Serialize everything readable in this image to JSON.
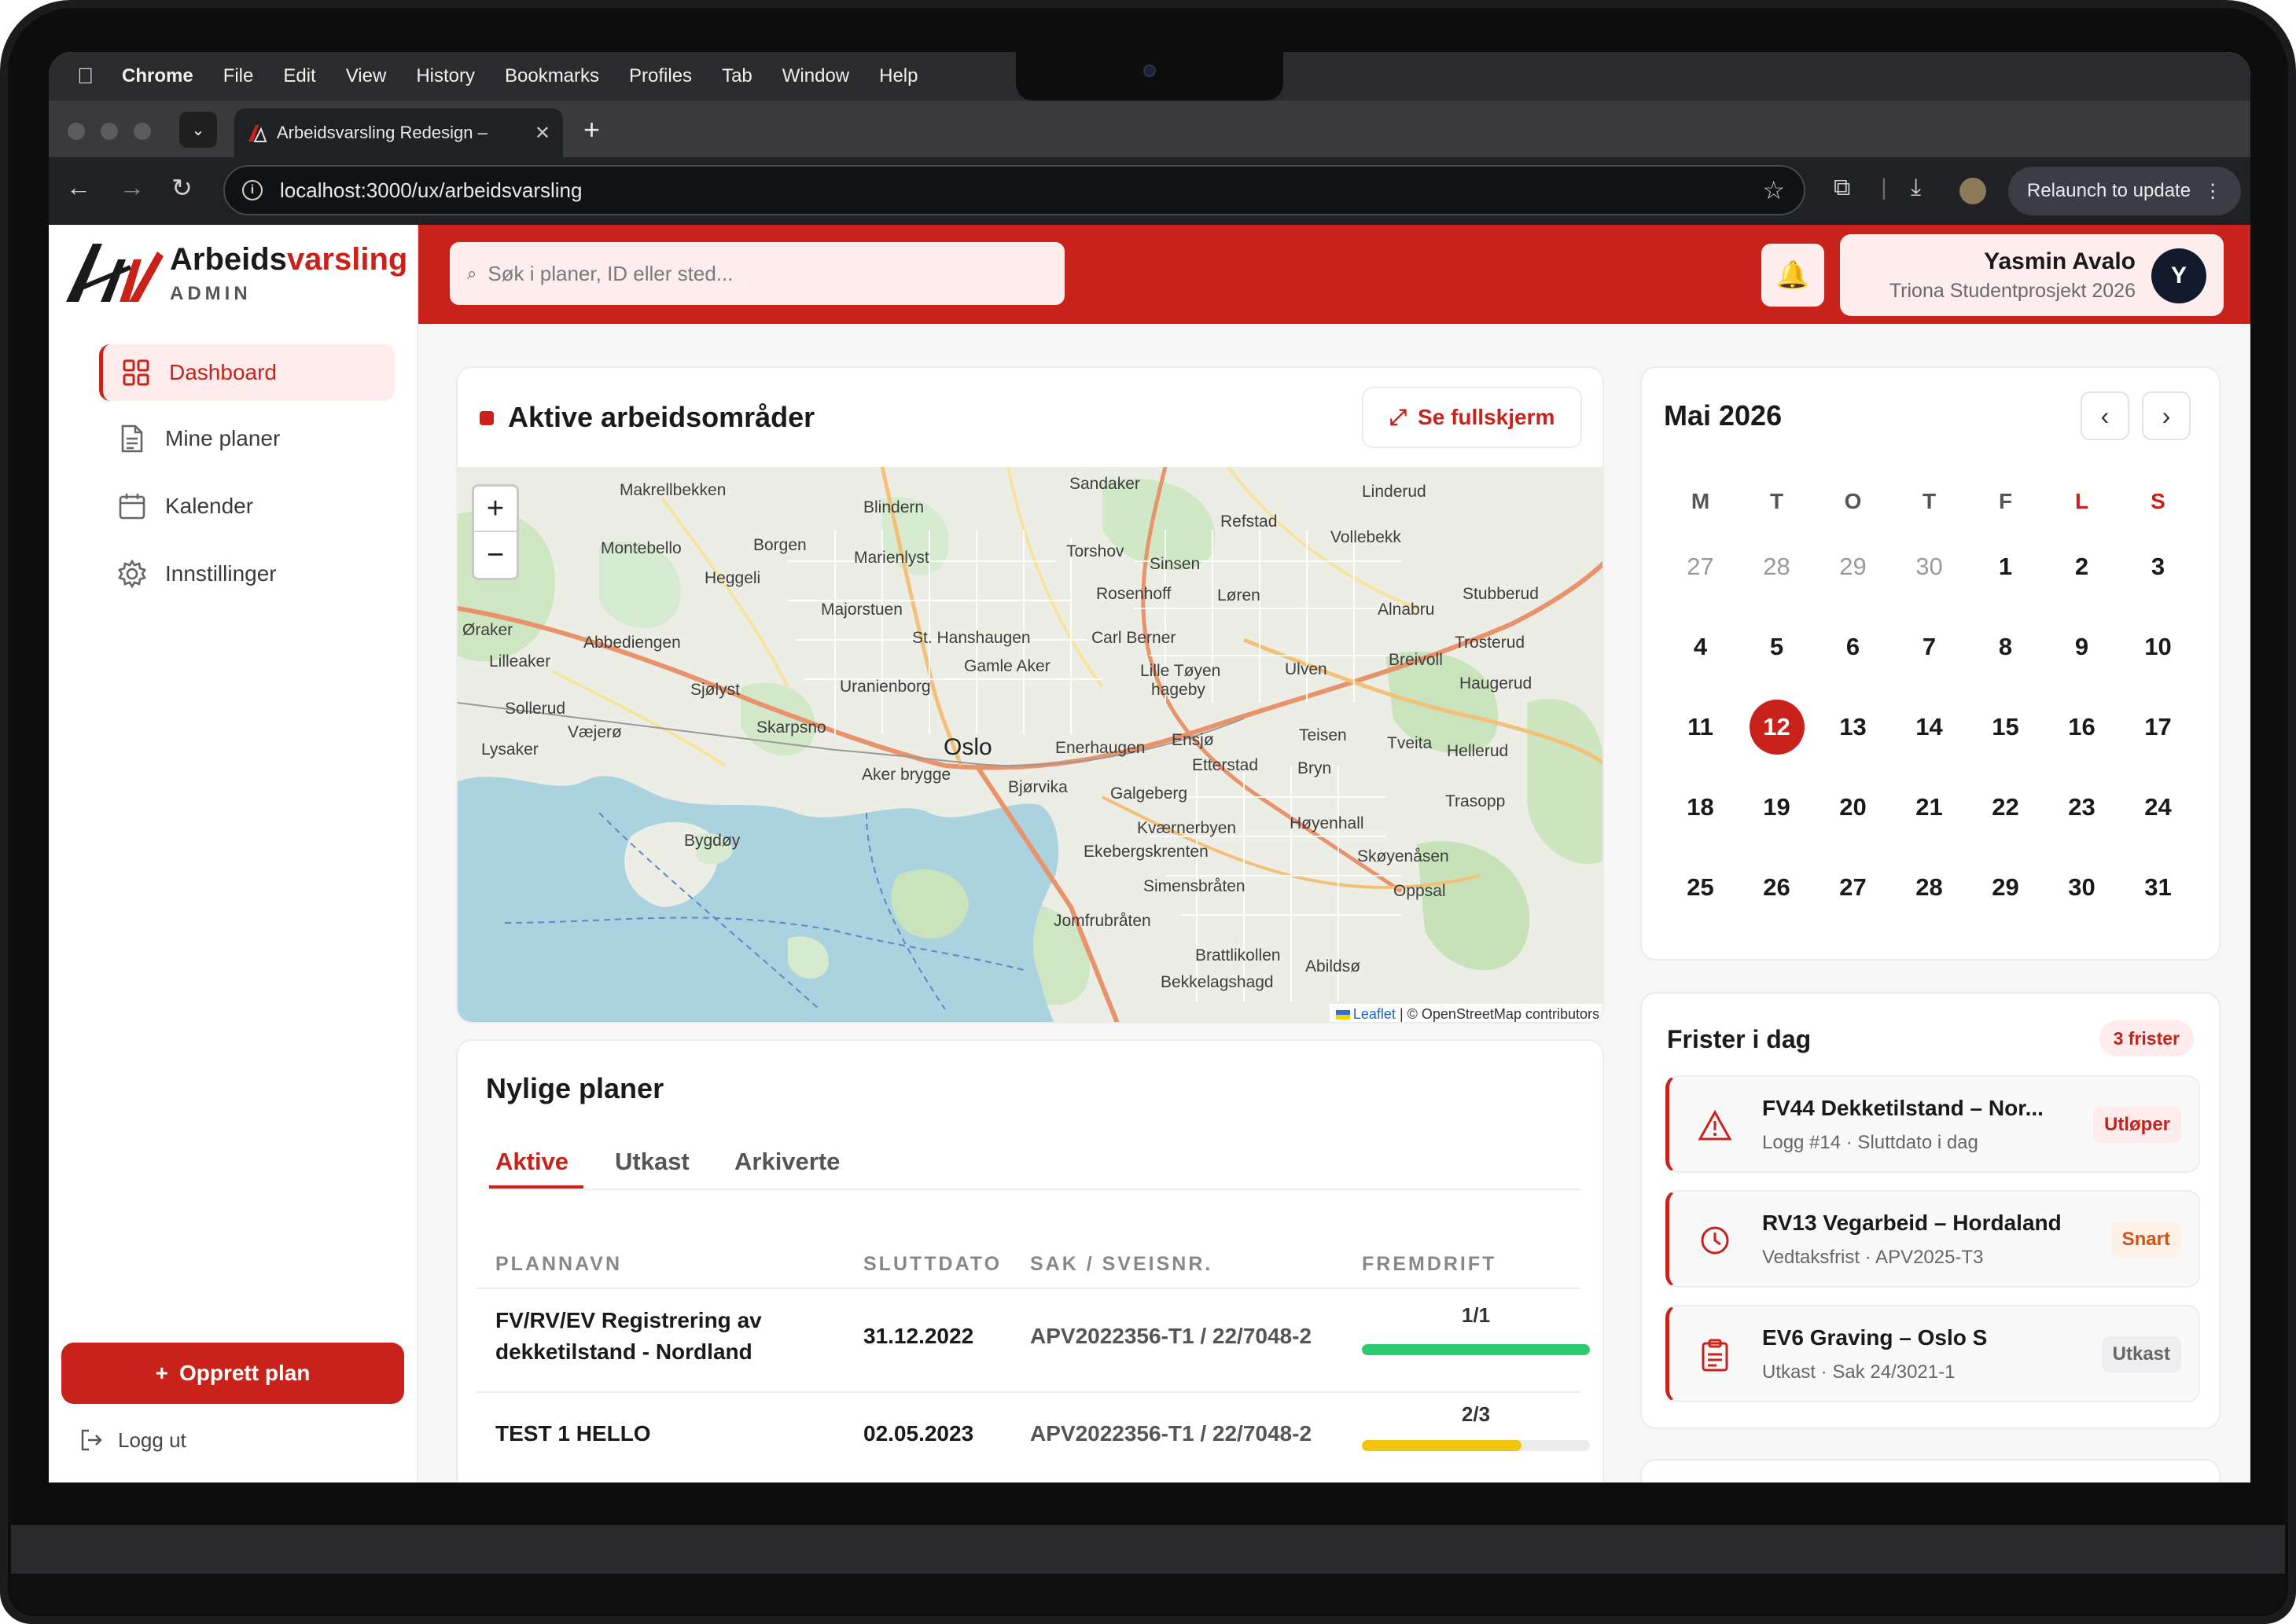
{
  "macos_menu": {
    "app": "Chrome",
    "items": [
      "File",
      "Edit",
      "View",
      "History",
      "Bookmarks",
      "Profiles",
      "Tab",
      "Window",
      "Help"
    ]
  },
  "browser": {
    "tab_title": "Arbeidsvarsling Redesign –",
    "url": "localhost:3000/ux/arbeidsvarsling",
    "relaunch_label": "Relaunch to update"
  },
  "brand": {
    "name_part1": "Arbeids",
    "name_part2": "varsling",
    "subtitle": "ADMIN",
    "accent_color": "#c8221a"
  },
  "sidebar": {
    "items": [
      {
        "label": "Dashboard",
        "icon": "grid-icon",
        "active": true
      },
      {
        "label": "Mine planer",
        "icon": "document-icon"
      },
      {
        "label": "Kalender",
        "icon": "calendar-icon"
      },
      {
        "label": "Innstillinger",
        "icon": "gear-icon"
      }
    ],
    "create_label": "Opprett plan",
    "logout_label": "Logg ut"
  },
  "header": {
    "search_placeholder": "Søk i planer, ID eller sted...",
    "user_name": "Yasmin Avalo",
    "user_org": "Triona Studentprosjekt 2026",
    "avatar_initial": "Y"
  },
  "map_section": {
    "title": "Aktive arbeidsområder",
    "fullscreen_label": "Se fullskjerm",
    "zoom_in": "+",
    "zoom_out": "−",
    "attribution_leaflet": "Leaflet",
    "attribution_osm": " | © OpenStreetMap contributors",
    "labels": [
      "Makrellbekken",
      "Blindern",
      "Sandaker",
      "Linderud",
      "Montebello",
      "Borgen",
      "Marienlyst",
      "Torshov",
      "Refstad",
      "Vollebekk",
      "Heggeli",
      "Sinsen",
      "Majorstuen",
      "Rosenhoff",
      "Løren",
      "Alnabru",
      "Stubberud",
      "Øraker",
      "Abbediengen",
      "St. Hanshaugen",
      "Carl Berner",
      "Trosterud",
      "Lilleaker",
      "Gamle Aker",
      "Lille Tøyen",
      "Ulven",
      "Breivoll",
      "Sjølyst",
      "Uranienborg",
      "hageby",
      "Haugerud",
      "Sollerud",
      "Skarpsno",
      "Oslo",
      "Enerhaugen",
      "Ensjø",
      "Teisen",
      "Tveita",
      "Hellerud",
      "Lysaker",
      "Væjerø",
      "Aker brygge",
      "Etterstad",
      "Bryn",
      "Bjørvika",
      "Galgeberg",
      "Trasopp",
      "Bygdøy",
      "Kværnerbyen",
      "Høyenhall",
      "Ekebergskrenten",
      "Skøyenåsen",
      "Simensbråten",
      "Oppsal",
      "Jomfrubråten",
      "Brattlikollen",
      "Abildsø",
      "Bekkelagshagd"
    ]
  },
  "plans": {
    "title": "Nylige planer",
    "tabs": [
      "Aktive",
      "Utkast",
      "Arkiverte"
    ],
    "columns": [
      "PLANNAVN",
      "SLUTTDATO",
      "SAK / SVEISNR.",
      "FREMDRIFT"
    ],
    "rows": [
      {
        "name_line1": "FV/RV/EV Registrering av",
        "name_line2": "dekketilstand - Nordland",
        "end_date": "31.12.2022",
        "case": "APV2022356-T1 / 22/7048-2",
        "progress_label": "1/1",
        "progress": 1.0,
        "color": "#2ecc71"
      },
      {
        "name_line1": "TEST 1 HELLO",
        "name_line2": "",
        "end_date": "02.05.2023",
        "case": "APV2022356-T1 / 22/7048-2",
        "progress_label": "2/3",
        "progress": 0.7,
        "color": "#f1c40f"
      }
    ]
  },
  "calendar": {
    "title": "Mai 2026",
    "prev": "‹",
    "next": "›",
    "weekdays": [
      "M",
      "T",
      "O",
      "T",
      "F",
      "L",
      "S"
    ],
    "weeks": [
      [
        "27",
        "28",
        "29",
        "30",
        "1",
        "2",
        "3"
      ],
      [
        "4",
        "5",
        "6",
        "7",
        "8",
        "9",
        "10"
      ],
      [
        "11",
        "12",
        "13",
        "14",
        "15",
        "16",
        "17"
      ],
      [
        "18",
        "19",
        "20",
        "21",
        "22",
        "23",
        "24"
      ],
      [
        "25",
        "26",
        "27",
        "28",
        "29",
        "30",
        "31"
      ]
    ],
    "today": "12"
  },
  "deadlines": {
    "title": "Frister i dag",
    "badge": "3 frister",
    "items": [
      {
        "name": "FV44 Dekketilstand – Nor...",
        "sub": "Logg #14 · Sluttdato i dag",
        "tag": "Utløper",
        "icon": "warning-icon"
      },
      {
        "name": "RV13 Vegarbeid – Hordaland",
        "sub": "Vedtaksfrist · APV2025-T3",
        "tag": "Snart",
        "icon": "clock-icon"
      },
      {
        "name": "EV6 Graving – Oslo S",
        "sub": "Utkast · Sak 24/3021-1",
        "tag": "Utkast",
        "icon": "clipboard-icon"
      }
    ]
  }
}
